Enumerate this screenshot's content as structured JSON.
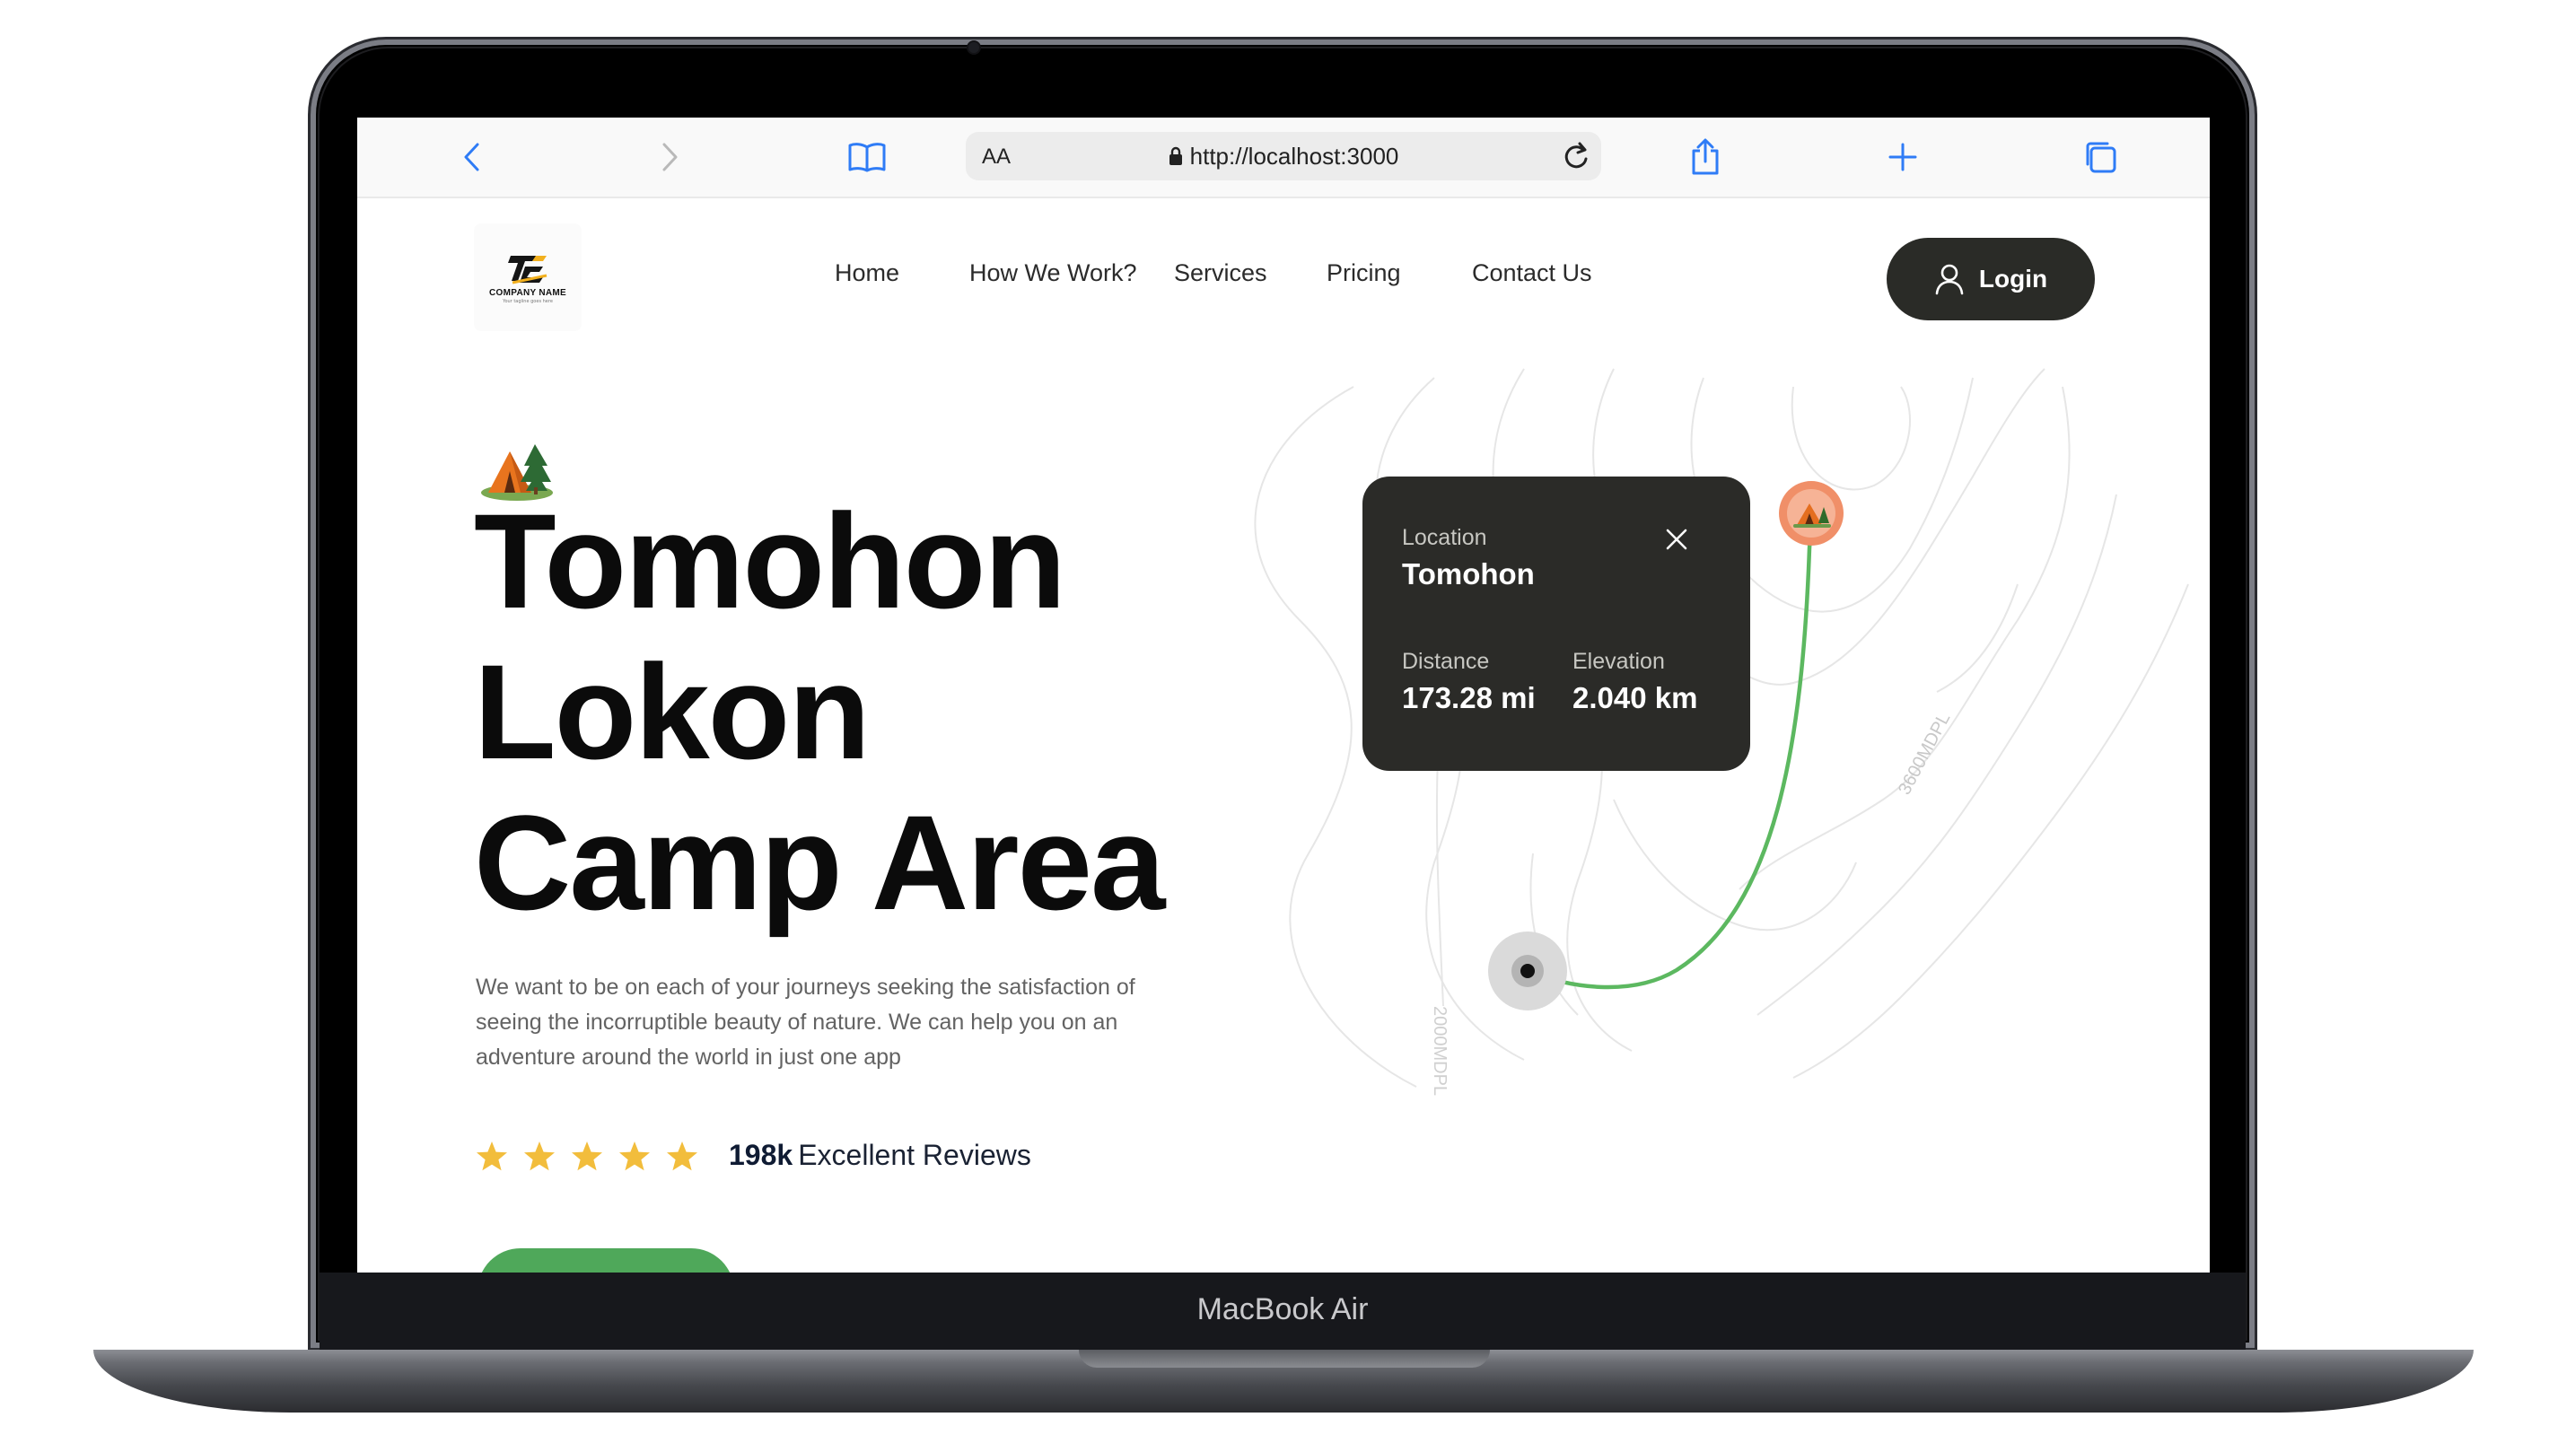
{
  "device": {
    "label": "MacBook Air"
  },
  "browser": {
    "text_size_label": "AA",
    "url": "http://localhost:3000",
    "icons": [
      "back-icon",
      "forward-icon",
      "bookmarks-icon",
      "lock-icon",
      "reload-icon",
      "share-icon",
      "new-tab-icon",
      "tabs-icon"
    ]
  },
  "site": {
    "logo": {
      "text": "COMPANY NAME",
      "tagline": "Your tagline goes here"
    },
    "nav": [
      "Home",
      "How We Work?",
      "Services",
      "Pricing",
      "Contact Us"
    ],
    "login_label": "Login"
  },
  "hero": {
    "title_lines": [
      "Tomohon",
      "Lokon",
      "Camp Area"
    ],
    "description": "We want to be on each of your journeys seeking the satisfaction of seeing the incorruptible beauty of nature. We can help you on an adventure around the world in just one app",
    "rating": {
      "stars": 5,
      "count": "198k",
      "label": "Excellent Reviews"
    },
    "cta_color": "#4fa85a"
  },
  "map": {
    "contour_labels": [
      "3600MDPL",
      "2000MDPL"
    ],
    "route_color": "#5cb860",
    "pin_color": "#f08f68",
    "card": {
      "location_label": "Location",
      "location_value": "Tomohon",
      "distance_label": "Distance",
      "distance_value": "173.28 mi",
      "elevation_label": "Elevation",
      "elevation_value": "2.040 km"
    }
  },
  "colors": {
    "dark": "#2b2b28",
    "star": "#f2bd3c",
    "accent_green": "#4fa85a"
  }
}
